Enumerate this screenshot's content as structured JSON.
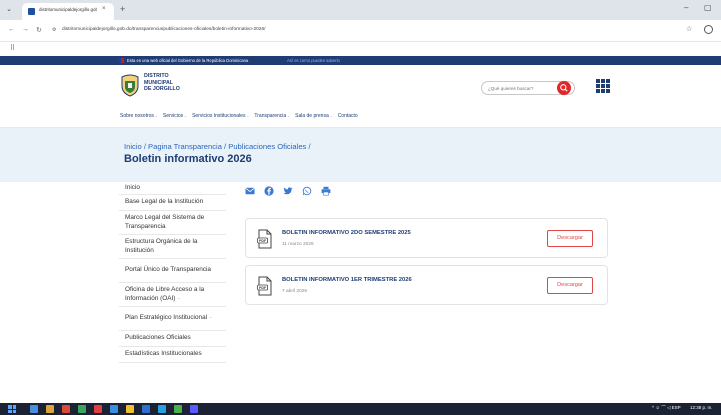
{
  "browser": {
    "tab_title": "distritomunicipaldejorgillo.gob",
    "tab_close": "×",
    "new_tab": "+",
    "url": "distritomunicipaldejorgillo.gob.do/transparencia/publicaciones-oficiales/boletin-informativo-2026/",
    "minimize": "–",
    "maximize": "▢"
  },
  "gov_banner": {
    "text": "Esta es una web oficial del Gobierno de la República Dominicana",
    "link": "Así es como puedes saberlo"
  },
  "header": {
    "logo_line1": "DISTRITO",
    "logo_line2": "MUNICIPAL",
    "logo_line3": "DE JORGILLO",
    "search_placeholder": "¿Qué quieres buscar?"
  },
  "nav": {
    "items": [
      {
        "label": "Sobre nosotros",
        "caret": true
      },
      {
        "label": "Servicios",
        "caret": true
      },
      {
        "label": "Servicios Institucionales",
        "caret": true
      },
      {
        "label": "Transparencia",
        "caret": true
      },
      {
        "label": "Sala de prensa",
        "caret": true
      },
      {
        "label": "Contacto",
        "caret": false
      }
    ],
    "caret_glyph": "⌄"
  },
  "hero": {
    "breadcrumb": "Inicio / Pagina Transparencia / Publicaciones Oficiales /",
    "title": "Boletin informativo 2026"
  },
  "sidebar": {
    "items": [
      {
        "label": "Inicio",
        "sub": false
      },
      {
        "label": "Base Legal de la Institución",
        "sub": false
      },
      {
        "label": "Marco Legal del Sistema de Transparencia",
        "sub": false
      },
      {
        "label": "Estructura Orgánica de la Institución",
        "sub": false
      },
      {
        "label": "Portal Único de Transparencia",
        "sub": false
      },
      {
        "label": "Oficina de Libre Acceso a la Información (OAI)",
        "sub": true
      },
      {
        "label": "Plan Estratégico Institucional",
        "sub": true
      },
      {
        "label": "Publicaciones Oficiales",
        "sub": false
      },
      {
        "label": "Estadísticas Institucionales",
        "sub": false
      }
    ],
    "sub_glyph": "–"
  },
  "documents": [
    {
      "title": "BOLETIN INFORMATIVO 2DO SEMESTRE 2025",
      "date": "11 marzo 2026",
      "button": "Descargar"
    },
    {
      "title": "BOLETIN INFORMATIVO 1ER TRIMESTRE 2026",
      "date": "7 abril 2026",
      "button": "Descargar"
    }
  ],
  "taskbar": {
    "tray": "^ ☺ ⌒ ◁ ESP",
    "clock": "12:38 p. m."
  },
  "colors": {
    "brand_navy": "#1f3c73",
    "accent_red": "#e02828",
    "hero_bg": "#e8f2f8",
    "link_blue": "#2a66c0"
  }
}
